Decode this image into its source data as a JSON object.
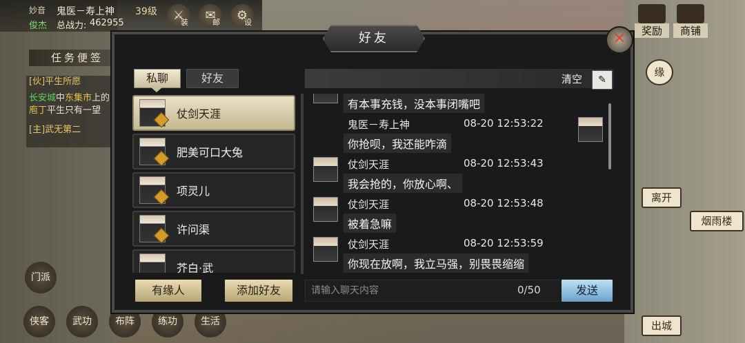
{
  "player": {
    "title_prefix": "妙音",
    "name": "鬼医－寿上神",
    "level": "39级",
    "nickname": "俊杰",
    "power_label": "总战力:",
    "power_value": "462955"
  },
  "top_icons": [
    {
      "icon": "armor-icon",
      "label": "装"
    },
    {
      "icon": "mail-icon",
      "label": "邮"
    },
    {
      "icon": "gear-icon",
      "label": "设"
    }
  ],
  "right_top_icons": [
    {
      "icon": "reward-icon",
      "label": "奖励"
    },
    {
      "icon": "shop-icon",
      "label": "商铺"
    }
  ],
  "quest": {
    "header": "任务便签",
    "lines": [
      {
        "tag": "[伙]",
        "text": "平生所愿"
      },
      {
        "place": "长安城",
        "mid": "中",
        "npc": "东集市",
        "rest": "上的",
        "npc2": "庖丁",
        "rest2": "平生只有一望"
      },
      {
        "tag": "[主]",
        "text": "武无第二"
      }
    ]
  },
  "right_menu": {
    "fate": "缘",
    "leave": "离开",
    "yanyu": "烟雨楼",
    "chucheng": "出城"
  },
  "bottom_icons": [
    "门派",
    "侠客",
    "武功",
    "布阵",
    "练功",
    "生活"
  ],
  "dialog": {
    "title": "好友",
    "tabs": [
      "私聊",
      "好友"
    ],
    "clear_label": "清空",
    "friends": [
      {
        "name": "仗剑天涯",
        "selected": true
      },
      {
        "name": "肥美可口大兔",
        "selected": false
      },
      {
        "name": "项灵儿",
        "selected": false
      },
      {
        "name": "许问渠",
        "selected": false
      },
      {
        "name": "芥白·武",
        "selected": false
      }
    ],
    "messages": [
      {
        "name": "",
        "time": "",
        "text": "有本事充钱，没本事闭嘴吧",
        "side": "left"
      },
      {
        "name": "鬼医－寿上神",
        "time": "08-20 12:53:22",
        "text": "你抢呗，我还能咋滴",
        "side": "right"
      },
      {
        "name": "仗剑天涯",
        "time": "08-20 12:53:43",
        "text": "我会抢的，你放心啊、",
        "side": "left"
      },
      {
        "name": "仗剑天涯",
        "time": "08-20 12:53:48",
        "text": "被着急嘛",
        "side": "left"
      },
      {
        "name": "仗剑天涯",
        "time": "08-20 12:53:59",
        "text": "你现在放啊，我立马强，别畏畏缩缩",
        "side": "left"
      }
    ],
    "buttons": {
      "fate_people": "有缘人",
      "add_friend": "添加好友",
      "send": "发送"
    },
    "input_placeholder": "请输入聊天内容",
    "counter": "0/50"
  },
  "colors": {
    "quest_tag": "#e7c56a",
    "place_link": "#5fd35f",
    "npc_link": "#e6c14a",
    "green_name": "#7bd96b"
  }
}
